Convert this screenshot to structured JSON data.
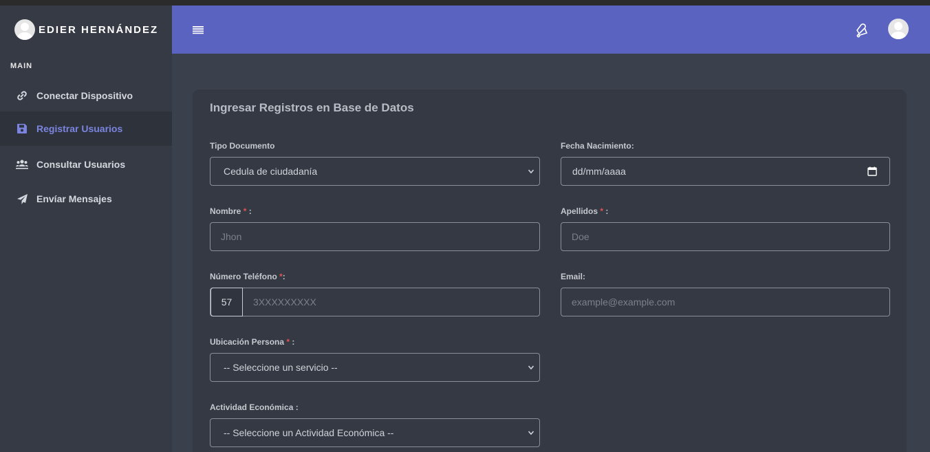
{
  "sidebar": {
    "user_name": "EDIER HERNÁNDEZ",
    "section_title": "MAIN",
    "items": [
      {
        "label": "Conectar Dispositivo",
        "icon": "link-icon"
      },
      {
        "label": "Registrar Usuarios",
        "icon": "save-icon",
        "active": true
      },
      {
        "label": "Consultar Usuarios",
        "icon": "users-icon"
      },
      {
        "label": "Envíar Mensajes",
        "icon": "send-icon"
      }
    ]
  },
  "header": {
    "menu_icon": "menu-icon",
    "notification_icon": "bell-icon",
    "avatar_icon": "user-avatar-icon",
    "accent_color": "#5a63c0"
  },
  "form": {
    "title": "Ingresar Registros en Base de Datos",
    "tipo_documento": {
      "label": "Tipo Documento",
      "value": "Cedula de ciudadanía"
    },
    "fecha_nacimiento": {
      "label": "Fecha Nacimiento:",
      "placeholder": "dd/mm/aaaa"
    },
    "nombre": {
      "label": "Nombre",
      "required_mark": "*",
      "suffix": " :",
      "placeholder": "Jhon"
    },
    "apellidos": {
      "label": "Apellidos",
      "required_mark": "*",
      "suffix": " :",
      "placeholder": "Doe"
    },
    "telefono": {
      "label": "Número Teléfono",
      "required_mark": "*",
      "suffix": ":",
      "prefix": "57",
      "placeholder": "3XXXXXXXXX"
    },
    "email": {
      "label": "Email:",
      "placeholder": "example@example.com"
    },
    "ubicacion": {
      "label": "Ubicación Persona",
      "required_mark": "*",
      "suffix": " :",
      "value": "-- Seleccione un servicio --"
    },
    "actividad": {
      "label": "Actividad Económica :",
      "value": "-- Seleccione un Actividad Económica --"
    }
  }
}
